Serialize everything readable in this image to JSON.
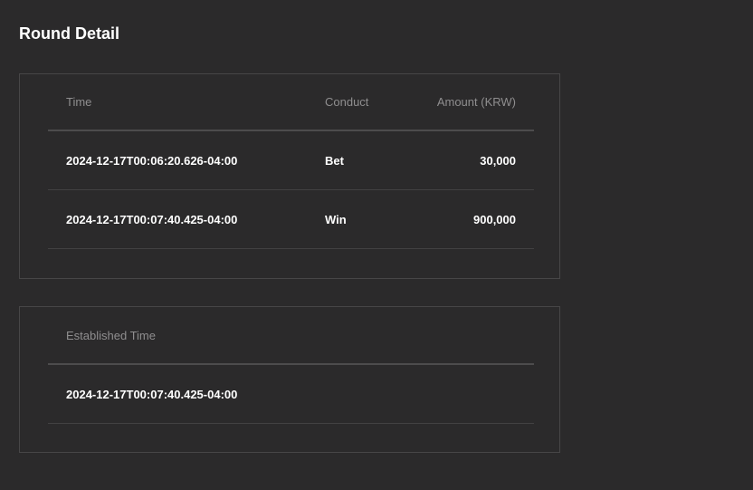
{
  "page": {
    "title": "Round Detail"
  },
  "rounds_table": {
    "headers": {
      "time": "Time",
      "conduct": "Conduct",
      "amount": "Amount (KRW)"
    },
    "rows": [
      {
        "time": "2024-12-17T00:06:20.626-04:00",
        "conduct": "Bet",
        "amount": "30,000"
      },
      {
        "time": "2024-12-17T00:07:40.425-04:00",
        "conduct": "Win",
        "amount": "900,000"
      }
    ]
  },
  "established": {
    "header": "Established Time",
    "value": "2024-12-17T00:07:40.425-04:00"
  }
}
